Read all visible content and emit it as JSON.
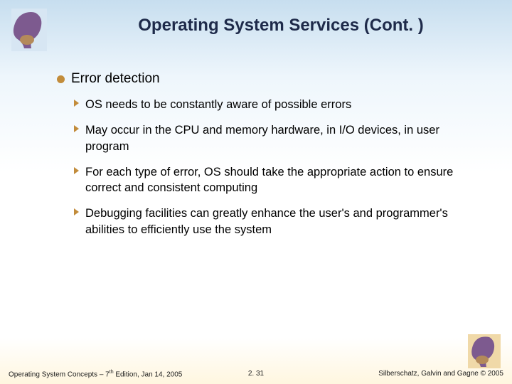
{
  "title": "Operating System Services (Cont. )",
  "level1": {
    "text": "Error detection"
  },
  "level2": [
    {
      "text": "OS needs to be constantly aware of possible errors"
    },
    {
      "text": "May occur in the CPU and memory hardware, in I/O devices, in user program"
    },
    {
      "text": "For each type of error, OS should take the appropriate action to ensure correct and consistent computing"
    },
    {
      "text": "Debugging facilities can greatly enhance the user's and programmer's abilities to efficiently use the system"
    }
  ],
  "footer": {
    "left_pre": "Operating System Concepts – 7",
    "left_sup": "th",
    "left_post": " Edition, Jan 14, 2005",
    "center": "2. 31",
    "right": "Silberschatz, Galvin and Gagne © 2005"
  },
  "icons": {
    "logo_alt": "dinosaur-logo"
  }
}
